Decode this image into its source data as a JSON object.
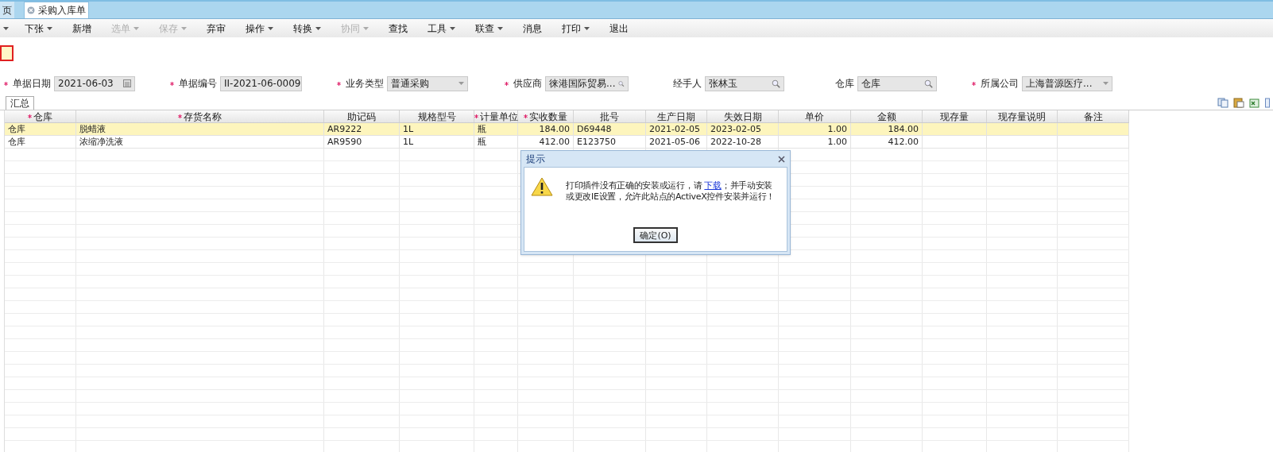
{
  "tabs": [
    {
      "label": "页",
      "selected": false,
      "closable": false
    },
    {
      "label": "采购入库单",
      "selected": true,
      "closable": true
    }
  ],
  "toolbar": [
    {
      "kind": "caret"
    },
    {
      "label": "下张",
      "has_menu": true,
      "disabled": false
    },
    {
      "label": "新增",
      "has_menu": false,
      "disabled": false
    },
    {
      "label": "选单",
      "has_menu": true,
      "disabled": true
    },
    {
      "label": "保存",
      "has_menu": true,
      "disabled": true
    },
    {
      "label": "弃审",
      "has_menu": false,
      "disabled": false
    },
    {
      "label": "操作",
      "has_menu": true,
      "disabled": false
    },
    {
      "label": "转换",
      "has_menu": true,
      "disabled": false
    },
    {
      "label": "协同",
      "has_menu": true,
      "disabled": true
    },
    {
      "label": "查找",
      "has_menu": false,
      "disabled": false
    },
    {
      "label": "工具",
      "has_menu": true,
      "disabled": false
    },
    {
      "label": "联查",
      "has_menu": true,
      "disabled": false
    },
    {
      "label": "消息",
      "has_menu": false,
      "disabled": false
    },
    {
      "label": "打印",
      "has_menu": true,
      "disabled": false
    },
    {
      "label": "退出",
      "has_menu": false,
      "disabled": false
    }
  ],
  "fields": [
    {
      "label": "单据日期",
      "required": true,
      "value": "2021-06-03",
      "kind": "date"
    },
    {
      "label": "单据编号",
      "required": true,
      "value": "II-2021-06-0009",
      "kind": "readonly"
    },
    {
      "label": "业务类型",
      "required": true,
      "value": "普通采购",
      "kind": "select"
    },
    {
      "label": "供应商",
      "required": true,
      "value": "徕港国际贸易...",
      "kind": "lookup"
    },
    {
      "label": "经手人",
      "required": false,
      "value": "张林玉",
      "kind": "lookup"
    },
    {
      "label": "仓库",
      "required": false,
      "value": "仓库",
      "kind": "lookup"
    },
    {
      "label": "所属公司",
      "required": true,
      "value": "上海普源医疗...",
      "kind": "select"
    }
  ],
  "grid_tabs": [
    {
      "label": "汇总",
      "selected": true
    }
  ],
  "grid": {
    "columns": [
      {
        "label": "仓库",
        "required": true,
        "kind": "text"
      },
      {
        "label": "存货名称",
        "required": true,
        "kind": "text"
      },
      {
        "label": "助记码",
        "required": false,
        "kind": "text"
      },
      {
        "label": "规格型号",
        "required": false,
        "kind": "text"
      },
      {
        "label": "计量单位",
        "required": true,
        "kind": "text"
      },
      {
        "label": "实收数量",
        "required": true,
        "kind": "number"
      },
      {
        "label": "批号",
        "required": false,
        "kind": "text"
      },
      {
        "label": "生产日期",
        "required": false,
        "kind": "text"
      },
      {
        "label": "失效日期",
        "required": false,
        "kind": "text"
      },
      {
        "label": "单价",
        "required": false,
        "kind": "number"
      },
      {
        "label": "金额",
        "required": false,
        "kind": "number"
      },
      {
        "label": "现存量",
        "required": false,
        "kind": "text"
      },
      {
        "label": "现存量说明",
        "required": false,
        "kind": "text"
      },
      {
        "label": "备注",
        "required": false,
        "kind": "text"
      }
    ],
    "rows": [
      {
        "selected": true,
        "cells": [
          "仓库",
          "脱蜡液",
          "AR9222",
          "1L",
          "瓶",
          "184.00",
          "D69448",
          "2021-02-05",
          "2023-02-05",
          "1.00",
          "184.00",
          null,
          null,
          null
        ]
      },
      {
        "selected": false,
        "cells": [
          "仓库",
          "浓缩净洗液",
          "AR9590",
          "1L",
          "瓶",
          "412.00",
          "E123750",
          "2021-05-06",
          "2022-10-28",
          "1.00",
          "412.00",
          null,
          null,
          null
        ]
      }
    ]
  },
  "dialog": {
    "title": "提示",
    "message_before": "打印插件没有正确的安装或运行，请 ",
    "link": "下载",
    "message_after": "；并手动安装或更改IE设置，允许此站点的ActiveX控件安装并运行！",
    "button": "确定(O)"
  }
}
